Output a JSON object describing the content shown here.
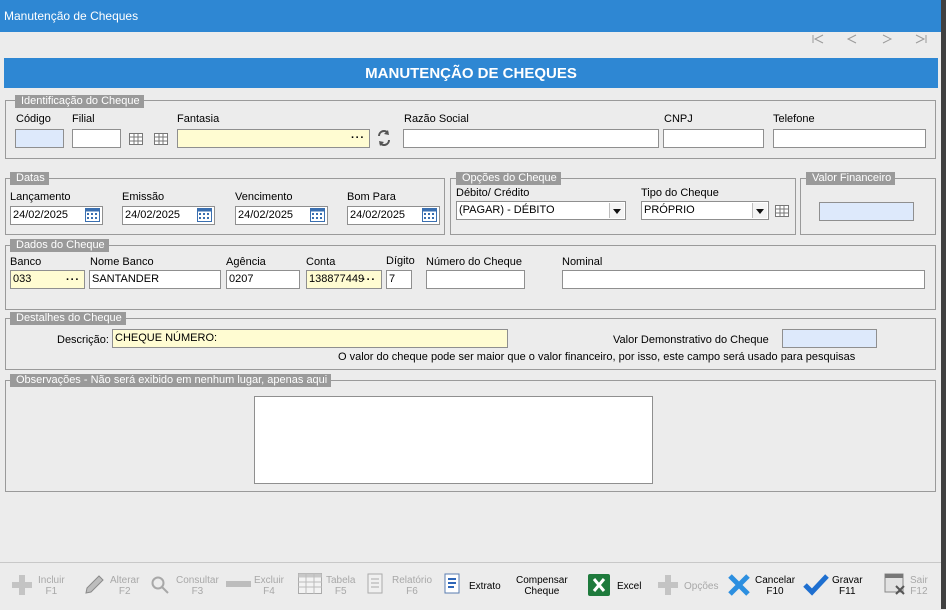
{
  "window": {
    "title": "Manutenção de Cheques"
  },
  "banner": {
    "title": "MANUTENÇÃO DE CHEQUES"
  },
  "identificacao": {
    "legend": "Identificação do Cheque",
    "codigo_label": "Código",
    "codigo_value": "",
    "filial_label": "Filial",
    "filial_value": "",
    "fantasia_label": "Fantasia",
    "fantasia_value": "",
    "razao_label": "Razão Social",
    "razao_value": "",
    "cnpj_label": "CNPJ",
    "cnpj_value": "",
    "telefone_label": "Telefone",
    "telefone_value": ""
  },
  "datas": {
    "legend": "Datas",
    "lancamento_label": "Lançamento",
    "lancamento_value": "24/02/2025",
    "emissao_label": "Emissão",
    "emissao_value": "24/02/2025",
    "vencimento_label": "Vencimento",
    "vencimento_value": "24/02/2025",
    "bompara_label": "Bom Para",
    "bompara_value": "24/02/2025"
  },
  "opcoes": {
    "legend": "Opções do Cheque",
    "debito_label": "Débito/ Crédito",
    "debito_value": "(PAGAR) - DÉBITO",
    "tipo_label": "Tipo do Cheque",
    "tipo_value": "PRÓPRIO"
  },
  "valor": {
    "legend": "Valor Financeiro",
    "value": ""
  },
  "dados": {
    "legend": "Dados do Cheque",
    "banco_label": "Banco",
    "banco_value": "033",
    "nomebanco_label": "Nome Banco",
    "nomebanco_value": "SANTANDER",
    "agencia_label": "Agência",
    "agencia_value": "0207",
    "conta_label": "Conta",
    "conta_value": "138877449",
    "digito_label": "Dígito",
    "digito_value": "7",
    "numero_label": "Número do Cheque",
    "numero_value": "",
    "nominal_label": "Nominal",
    "nominal_value": ""
  },
  "detalhes": {
    "legend": "Destalhes do Cheque",
    "descricao_label": "Descrição:",
    "descricao_value": "CHEQUE NÚMERO:",
    "valor_demo_label": "Valor Demonstrativo do Cheque",
    "valor_demo_value": "",
    "hint": "O valor do cheque pode ser maior que o valor financeiro, por isso, este campo será usado para pesquisas"
  },
  "observacoes": {
    "legend": "Observações - Não será exibido em nenhum lugar, apenas aqui",
    "value": ""
  },
  "toolbar": {
    "incluir": [
      "Incluir",
      "F1"
    ],
    "alterar": [
      "Alterar",
      "F2"
    ],
    "consultar": [
      "Consultar",
      "F3"
    ],
    "excluir": [
      "Excluir",
      "F4"
    ],
    "tabela": [
      "Tabela",
      "F5"
    ],
    "relatorio": [
      "Relatório",
      "F6"
    ],
    "extrato": "Extrato",
    "compensar": [
      "Compensar",
      "Cheque"
    ],
    "excel": "Excel",
    "opcoes": "Opções",
    "cancelar": [
      "Cancelar",
      "F10"
    ],
    "gravar": [
      "Gravar",
      "F11"
    ],
    "sair": [
      "Sair",
      "F12"
    ]
  }
}
